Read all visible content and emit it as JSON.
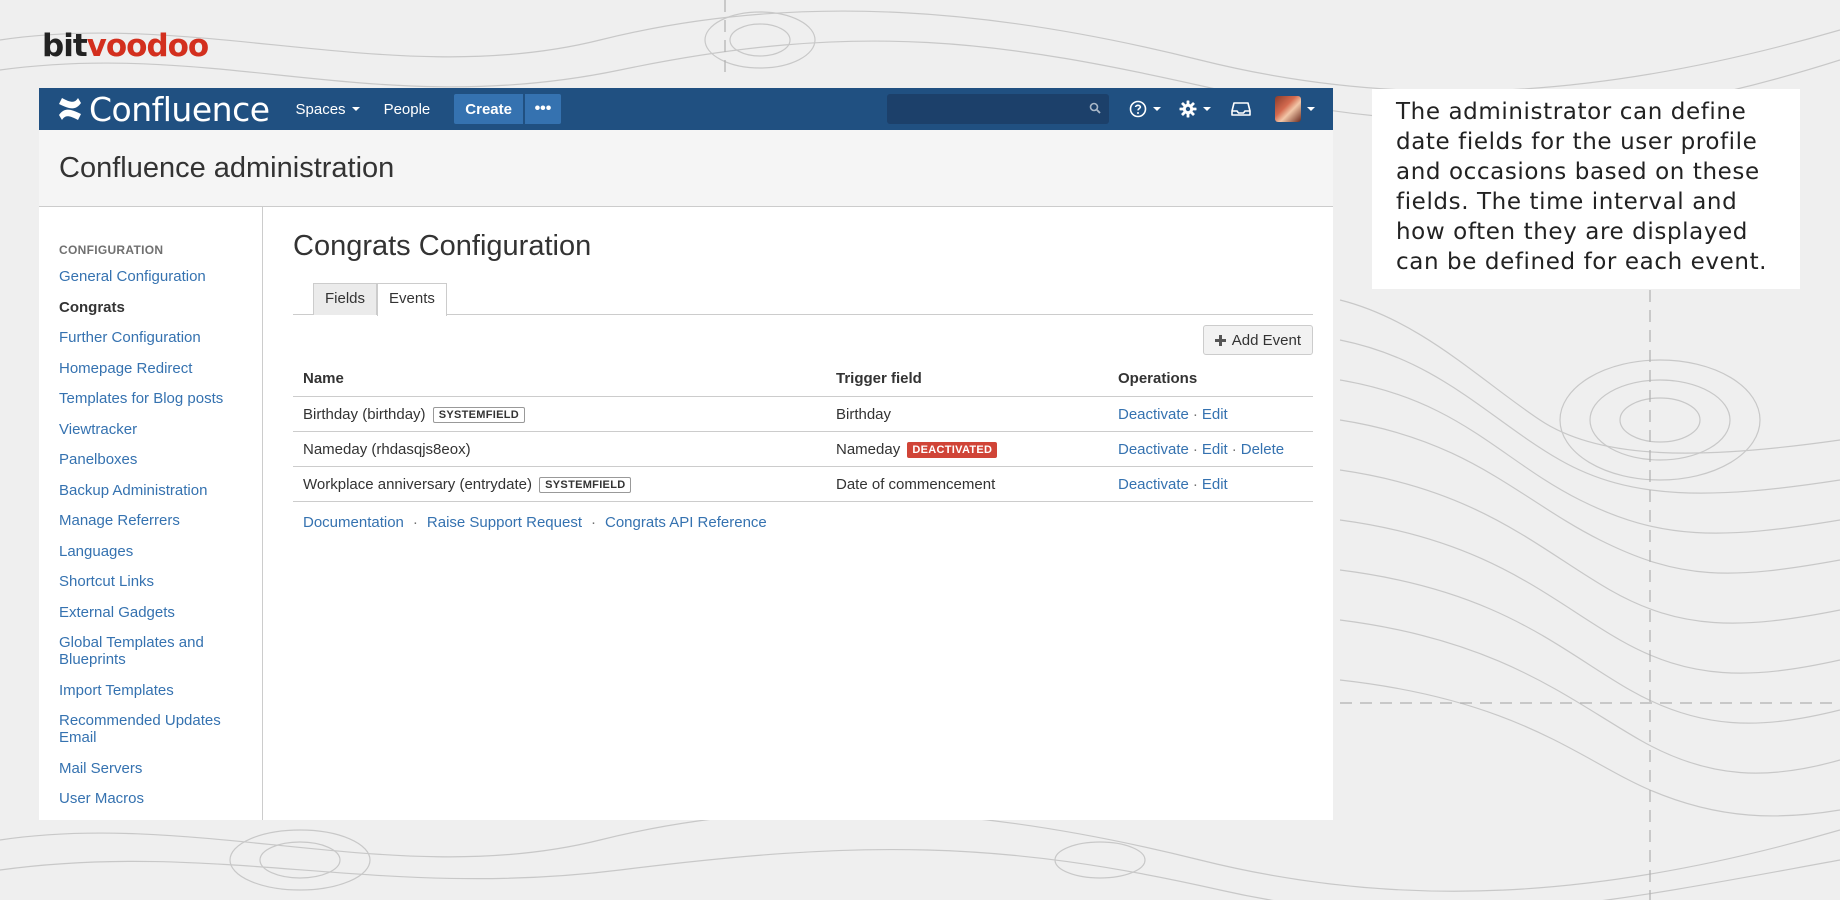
{
  "brand": {
    "logo_part1": "bit",
    "logo_part2": "voodoo"
  },
  "navbar": {
    "product_name": "Confluence",
    "spaces_label": "Spaces",
    "people_label": "People",
    "create_label": "Create",
    "more_label": "•••",
    "search": {
      "placeholder": "",
      "value": ""
    }
  },
  "admin": {
    "title": "Confluence administration"
  },
  "sidebar": {
    "heading": "CONFIGURATION",
    "items": [
      {
        "label": "General Configuration",
        "active": false
      },
      {
        "label": "Congrats",
        "active": true
      },
      {
        "label": "Further Configuration",
        "active": false
      },
      {
        "label": "Homepage Redirect",
        "active": false
      },
      {
        "label": "Templates for Blog posts",
        "active": false
      },
      {
        "label": "Viewtracker",
        "active": false
      },
      {
        "label": "Panelboxes",
        "active": false
      },
      {
        "label": "Backup Administration",
        "active": false
      },
      {
        "label": "Manage Referrers",
        "active": false
      },
      {
        "label": "Languages",
        "active": false
      },
      {
        "label": "Shortcut Links",
        "active": false
      },
      {
        "label": "External Gadgets",
        "active": false
      },
      {
        "label": "Global Templates and Blueprints",
        "active": false
      },
      {
        "label": "Import Templates",
        "active": false
      },
      {
        "label": "Recommended Updates Email",
        "active": false
      },
      {
        "label": "Mail Servers",
        "active": false
      },
      {
        "label": "User Macros",
        "active": false
      }
    ]
  },
  "main": {
    "title": "Congrats Configuration",
    "tabs": [
      {
        "label": "Fields",
        "active": false
      },
      {
        "label": "Events",
        "active": true
      }
    ],
    "add_event_label": "Add Event",
    "table": {
      "headers": {
        "name": "Name",
        "trigger": "Trigger field",
        "operations": "Operations"
      },
      "rows": [
        {
          "name": "Birthday (birthday)",
          "name_badge": "SYSTEMFIELD",
          "trigger": "Birthday",
          "trigger_badge": "",
          "ops": [
            "Deactivate",
            "Edit"
          ]
        },
        {
          "name": "Nameday (rhdasqjs8eox)",
          "name_badge": "",
          "trigger": "Nameday",
          "trigger_badge": "DEACTIVATED",
          "ops": [
            "Deactivate",
            "Edit",
            "Delete"
          ]
        },
        {
          "name": "Workplace anniversary (entrydate)",
          "name_badge": "SYSTEMFIELD",
          "trigger": "Date of commencement",
          "trigger_badge": "",
          "ops": [
            "Deactivate",
            "Edit"
          ]
        }
      ],
      "op_separator": "·"
    },
    "footer_links": [
      "Documentation",
      "Raise Support Request",
      "Congrats API Reference"
    ],
    "footer_separator": "·"
  },
  "callout": {
    "text": "The administrator can define date fields for the user profile and occasions based on these fields. The time interval and how often they are displayed can be defined for each event."
  },
  "colors": {
    "navbar_bg": "#205081",
    "button_blue": "#3572b0",
    "link_blue": "#3572b0",
    "deactivated_red": "#d04437",
    "logo_red": "#d32f1e"
  }
}
